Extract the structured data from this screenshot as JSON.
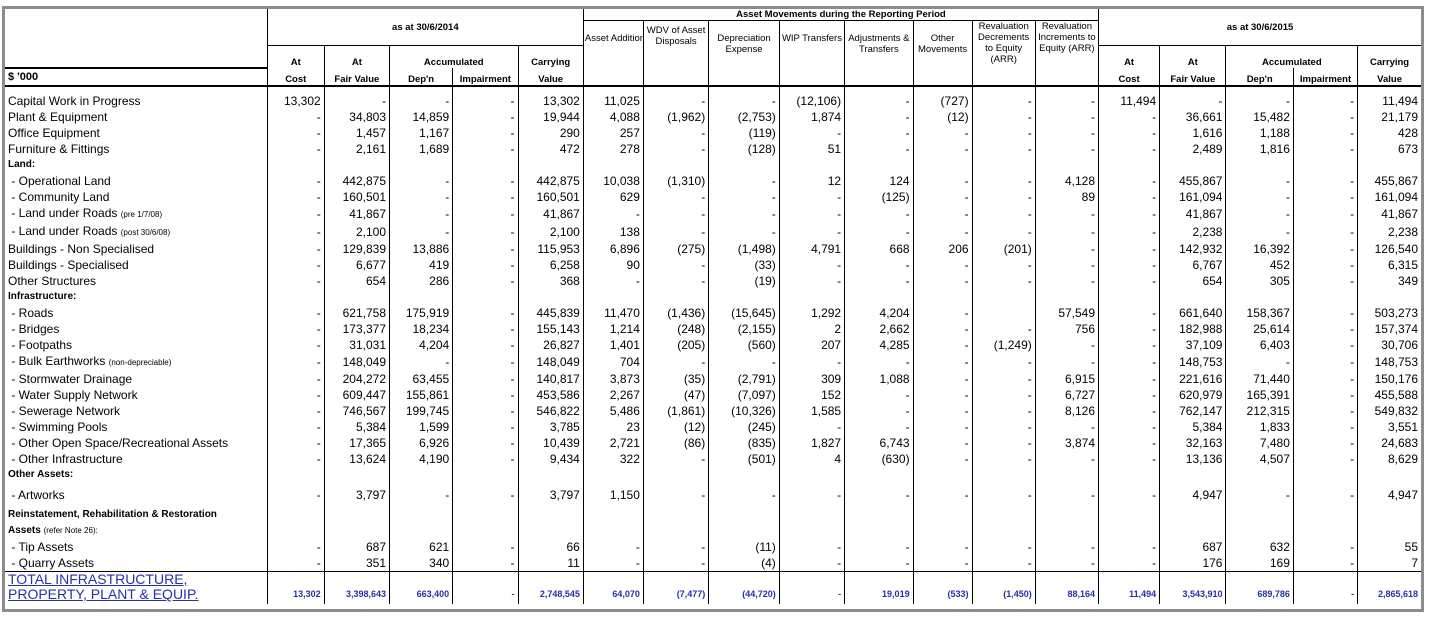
{
  "header": {
    "units": "$ '000",
    "group_2014": "as at 30/6/2014",
    "group_movements": "Asset Movements during the Reporting Period",
    "group_2015": "as at 30/6/2015",
    "cols_2014": {
      "at1": "At",
      "cost": "Cost",
      "at2": "At",
      "fair_value": "Fair Value",
      "accumulated": "Accumulated",
      "depn": "Dep'n",
      "impairment": "Impairment",
      "carrying": "Carrying",
      "value": "Value"
    },
    "cols_mov": {
      "additions": "Asset Additions",
      "wdv": "WDV of Asset Disposals",
      "depreciation": "Depreciation Expense",
      "wip": "WIP Transfers",
      "adjustments": "Adjustments & Transfers",
      "other": "Other Movements",
      "reval_dec": "Revaluation Decrements to Equity (ARR)",
      "reval_inc": "Revaluation Increments to Equity (ARR)"
    },
    "cols_2015": {
      "at1": "At",
      "cost": "Cost",
      "at2": "At",
      "fair_value": "Fair Value",
      "accumulated": "Accumulated",
      "depn": "Dep'n",
      "impairment": "Impairment",
      "carrying": "Carrying",
      "value": "Value"
    }
  },
  "rows": [
    {
      "type": "data",
      "label": "Capital Work in Progress",
      "values": [
        "13,302",
        "-",
        "-",
        "-",
        "13,302",
        "11,025",
        "-",
        "-",
        "(12,106)",
        "-",
        "(727)",
        "-",
        "-",
        "11,494",
        "-",
        "-",
        "-",
        "11,494"
      ]
    },
    {
      "type": "data",
      "label": "Plant & Equipment",
      "values": [
        "-",
        "34,803",
        "14,859",
        "-",
        "19,944",
        "4,088",
        "(1,962)",
        "(2,753)",
        "1,874",
        "-",
        "(12)",
        "-",
        "-",
        "-",
        "36,661",
        "15,482",
        "-",
        "21,179"
      ]
    },
    {
      "type": "data",
      "label": "Office Equipment",
      "values": [
        "-",
        "1,457",
        "1,167",
        "-",
        "290",
        "257",
        "-",
        "(119)",
        "-",
        "-",
        "-",
        "-",
        "-",
        "-",
        "1,616",
        "1,188",
        "-",
        "428"
      ]
    },
    {
      "type": "data",
      "label": "Furniture & Fittings",
      "values": [
        "-",
        "2,161",
        "1,689",
        "-",
        "472",
        "278",
        "-",
        "(128)",
        "51",
        "-",
        "-",
        "-",
        "-",
        "-",
        "2,489",
        "1,816",
        "-",
        "673"
      ]
    },
    {
      "type": "heading",
      "label": "Land:"
    },
    {
      "type": "data",
      "label": " - Operational Land",
      "values": [
        "-",
        "442,875",
        "-",
        "-",
        "442,875",
        "10,038",
        "(1,310)",
        "-",
        "12",
        "124",
        "-",
        "-",
        "4,128",
        "-",
        "455,867",
        "-",
        "-",
        "455,867"
      ]
    },
    {
      "type": "data",
      "label": " - Community Land",
      "values": [
        "-",
        "160,501",
        "-",
        "-",
        "160,501",
        "629",
        "-",
        "-",
        "-",
        "(125)",
        "-",
        "-",
        "89",
        "-",
        "161,094",
        "-",
        "-",
        "161,094"
      ]
    },
    {
      "type": "data",
      "label": " - Land under Roads",
      "note": "(pre 1/7/08)",
      "values": [
        "-",
        "41,867",
        "-",
        "-",
        "41,867",
        "-",
        "-",
        "-",
        "-",
        "-",
        "-",
        "-",
        "-",
        "-",
        "41,867",
        "-",
        "-",
        "41,867"
      ]
    },
    {
      "type": "data",
      "label": " - Land under Roads",
      "note": "(post 30/6/08)",
      "values": [
        "-",
        "2,100",
        "-",
        "-",
        "2,100",
        "138",
        "-",
        "-",
        "-",
        "-",
        "-",
        "-",
        "-",
        "-",
        "2,238",
        "-",
        "-",
        "2,238"
      ]
    },
    {
      "type": "data",
      "label": "Buildings - Non Specialised",
      "values": [
        "-",
        "129,839",
        "13,886",
        "-",
        "115,953",
        "6,896",
        "(275)",
        "(1,498)",
        "4,791",
        "668",
        "206",
        "(201)",
        "-",
        "-",
        "142,932",
        "16,392",
        "-",
        "126,540"
      ]
    },
    {
      "type": "data",
      "label": "Buildings - Specialised",
      "values": [
        "-",
        "6,677",
        "419",
        "-",
        "6,258",
        "90",
        "-",
        "(33)",
        "-",
        "-",
        "-",
        "-",
        "-",
        "-",
        "6,767",
        "452",
        "-",
        "6,315"
      ]
    },
    {
      "type": "data",
      "label": "Other Structures",
      "values": [
        "-",
        "654",
        "286",
        "-",
        "368",
        "-",
        "-",
        "(19)",
        "-",
        "-",
        "-",
        "-",
        "-",
        "-",
        "654",
        "305",
        "-",
        "349"
      ]
    },
    {
      "type": "heading",
      "label": "Infrastructure:"
    },
    {
      "type": "data",
      "label": " - Roads",
      "values": [
        "-",
        "621,758",
        "175,919",
        "-",
        "445,839",
        "11,470",
        "(1,436)",
        "(15,645)",
        "1,292",
        "4,204",
        "-",
        "",
        "57,549",
        "-",
        "661,640",
        "158,367",
        "-",
        "503,273"
      ]
    },
    {
      "type": "data",
      "label": " - Bridges",
      "values": [
        "-",
        "173,377",
        "18,234",
        "-",
        "155,143",
        "1,214",
        "(248)",
        "(2,155)",
        "2",
        "2,662",
        "-",
        "-",
        "756",
        "-",
        "182,988",
        "25,614",
        "-",
        "157,374"
      ]
    },
    {
      "type": "data",
      "label": " - Footpaths",
      "values": [
        "-",
        "31,031",
        "4,204",
        "-",
        "26,827",
        "1,401",
        "(205)",
        "(560)",
        "207",
        "4,285",
        "-",
        "(1,249)",
        "-",
        "-",
        "37,109",
        "6,403",
        "-",
        "30,706"
      ]
    },
    {
      "type": "data",
      "label": " - Bulk Earthworks",
      "note": "(non-depreciable)",
      "values": [
        "-",
        "148,049",
        "-",
        "-",
        "148,049",
        "704",
        "-",
        "-",
        "-",
        "-",
        "-",
        "-",
        "-",
        "-",
        "148,753",
        "-",
        "-",
        "148,753"
      ]
    },
    {
      "type": "data",
      "label": " - Stormwater Drainage",
      "values": [
        "-",
        "204,272",
        "63,455",
        "-",
        "140,817",
        "3,873",
        "(35)",
        "(2,791)",
        "309",
        "1,088",
        "-",
        "-",
        "6,915",
        "-",
        "221,616",
        "71,440",
        "-",
        "150,176"
      ]
    },
    {
      "type": "data",
      "label": " - Water Supply Network",
      "values": [
        "-",
        "609,447",
        "155,861",
        "-",
        "453,586",
        "2,267",
        "(47)",
        "(7,097)",
        "152",
        "-",
        "-",
        "-",
        "6,727",
        "-",
        "620,979",
        "165,391",
        "-",
        "455,588"
      ]
    },
    {
      "type": "data",
      "label": " - Sewerage Network",
      "values": [
        "-",
        "746,567",
        "199,745",
        "-",
        "546,822",
        "5,486",
        "(1,861)",
        "(10,326)",
        "1,585",
        "-",
        "-",
        "-",
        "8,126",
        "-",
        "762,147",
        "212,315",
        "-",
        "549,832"
      ]
    },
    {
      "type": "data",
      "label": " - Swimming Pools",
      "values": [
        "-",
        "5,384",
        "1,599",
        "-",
        "3,785",
        "23",
        "(12)",
        "(245)",
        "-",
        "-",
        "-",
        "-",
        "-",
        "-",
        "5,384",
        "1,833",
        "-",
        "3,551"
      ]
    },
    {
      "type": "data",
      "label": " - Other Open Space/Recreational Assets",
      "values": [
        "-",
        "17,365",
        "6,926",
        "-",
        "10,439",
        "2,721",
        "(86)",
        "(835)",
        "1,827",
        "6,743",
        "-",
        "-",
        "3,874",
        "-",
        "32,163",
        "7,480",
        "-",
        "24,683"
      ]
    },
    {
      "type": "data",
      "label": " - Other Infrastructure",
      "values": [
        "-",
        "13,624",
        "4,190",
        "-",
        "9,434",
        "322",
        "-",
        "(501)",
        "4",
        "(630)",
        "-",
        "-",
        "-",
        "-",
        "13,136",
        "4,507",
        "-",
        "8,629"
      ]
    },
    {
      "type": "heading",
      "label": "Other Assets:"
    },
    {
      "type": "data",
      "tall": true,
      "label": " - Artworks",
      "values": [
        "-",
        "3,797",
        "-",
        "-",
        "3,797",
        "1,150",
        "-",
        "-",
        "-",
        "-",
        "-",
        "-",
        "-",
        "-",
        "4,947",
        "-",
        "-",
        "4,947"
      ]
    },
    {
      "type": "heading",
      "label": "Reinstatement, Rehabilitation & Restoration"
    },
    {
      "type": "heading",
      "label": "Assets",
      "note": "(refer Note 26):"
    },
    {
      "type": "data",
      "label": " - Tip Assets",
      "values": [
        "-",
        "687",
        "621",
        "-",
        "66",
        "-",
        "-",
        "(11)",
        "-",
        "-",
        "-",
        "-",
        "-",
        "-",
        "687",
        "632",
        "-",
        "55"
      ]
    },
    {
      "type": "data",
      "label": " - Quarry Assets",
      "values": [
        "-",
        "351",
        "340",
        "-",
        "11",
        "-",
        "-",
        "(4)",
        "-",
        "-",
        "-",
        "-",
        "-",
        "-",
        "176",
        "169",
        "-",
        "7"
      ]
    }
  ],
  "total": {
    "label_line1": "TOTAL INFRASTRUCTURE,",
    "label_line2": "PROPERTY, PLANT & EQUIP.",
    "values": [
      "13,302",
      "3,398,643",
      "663,400",
      "-",
      "2,748,545",
      "64,070",
      "(7,477)",
      "(44,720)",
      "-",
      "19,019",
      "(533)",
      "(1,450)",
      "88,164",
      "11,494",
      "3,543,910",
      "689,786",
      "-",
      "2,865,618"
    ]
  }
}
